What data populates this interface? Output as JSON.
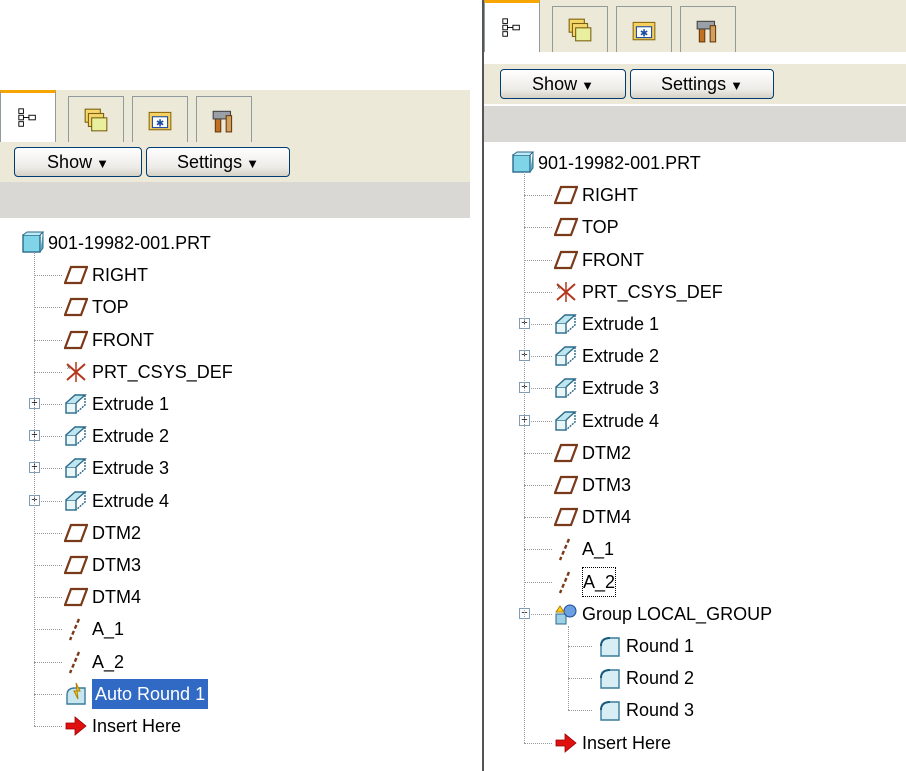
{
  "tabs": [
    {
      "name": "model-tree-icon"
    },
    {
      "name": "layers-icon"
    },
    {
      "name": "folder-browser-icon"
    },
    {
      "name": "tools-icon"
    }
  ],
  "toolbar": {
    "show_label": "Show",
    "settings_label": "Settings"
  },
  "left_tree": {
    "root": "901-19982-001.PRT",
    "items": [
      {
        "label": "RIGHT",
        "icon": "datum-plane-icon"
      },
      {
        "label": "TOP",
        "icon": "datum-plane-icon"
      },
      {
        "label": "FRONT",
        "icon": "datum-plane-icon"
      },
      {
        "label": "PRT_CSYS_DEF",
        "icon": "csys-icon"
      },
      {
        "label": "Extrude 1",
        "icon": "extrude-icon",
        "expandable": true
      },
      {
        "label": "Extrude 2",
        "icon": "extrude-icon",
        "expandable": true
      },
      {
        "label": "Extrude 3",
        "icon": "extrude-icon",
        "expandable": true
      },
      {
        "label": "Extrude 4",
        "icon": "extrude-icon",
        "expandable": true
      },
      {
        "label": "DTM2",
        "icon": "datum-plane-icon"
      },
      {
        "label": "DTM3",
        "icon": "datum-plane-icon"
      },
      {
        "label": "DTM4",
        "icon": "datum-plane-icon"
      },
      {
        "label": "A_1",
        "icon": "datum-axis-icon"
      },
      {
        "label": "A_2",
        "icon": "datum-axis-icon"
      },
      {
        "label": "Auto Round 1",
        "icon": "auto-round-icon",
        "selected": true
      },
      {
        "label": "Insert Here",
        "icon": "insert-arrow-icon"
      }
    ]
  },
  "right_tree": {
    "root": "901-19982-001.PRT",
    "items": [
      {
        "label": "RIGHT",
        "icon": "datum-plane-icon"
      },
      {
        "label": "TOP",
        "icon": "datum-plane-icon"
      },
      {
        "label": "FRONT",
        "icon": "datum-plane-icon"
      },
      {
        "label": "PRT_CSYS_DEF",
        "icon": "csys-icon"
      },
      {
        "label": "Extrude 1",
        "icon": "extrude-icon",
        "expandable": true
      },
      {
        "label": "Extrude 2",
        "icon": "extrude-icon",
        "expandable": true
      },
      {
        "label": "Extrude 3",
        "icon": "extrude-icon",
        "expandable": true
      },
      {
        "label": "Extrude 4",
        "icon": "extrude-icon",
        "expandable": true
      },
      {
        "label": "DTM2",
        "icon": "datum-plane-icon"
      },
      {
        "label": "DTM3",
        "icon": "datum-plane-icon"
      },
      {
        "label": "DTM4",
        "icon": "datum-plane-icon"
      },
      {
        "label": "A_1",
        "icon": "datum-axis-icon"
      },
      {
        "label": "A_2",
        "icon": "datum-axis-icon",
        "focused": true
      },
      {
        "label": "Group LOCAL_GROUP",
        "icon": "group-icon",
        "expanded": true
      },
      {
        "label": "Round 1",
        "icon": "round-icon",
        "child": true
      },
      {
        "label": "Round 2",
        "icon": "round-icon",
        "child": true
      },
      {
        "label": "Round 3",
        "icon": "round-icon",
        "child": true
      },
      {
        "label": "Insert Here",
        "icon": "insert-arrow-icon"
      }
    ]
  },
  "colors": {
    "selection": "#316ac5",
    "active_tab_accent": "#f7a500",
    "datum": "#7a3a1a"
  }
}
